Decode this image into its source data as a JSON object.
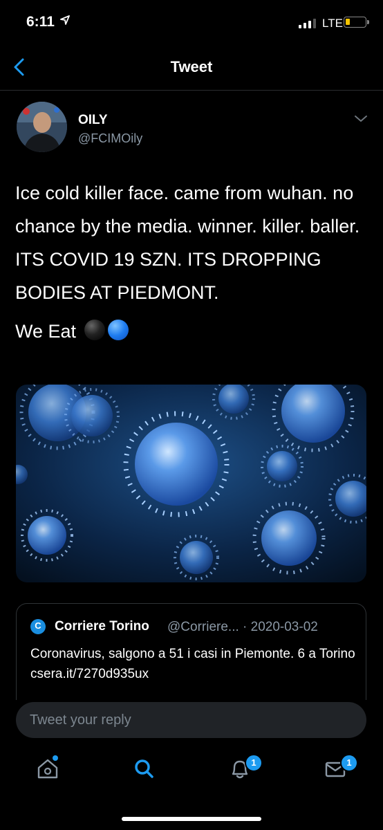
{
  "status_bar": {
    "time": "6:11",
    "network": "LTE"
  },
  "nav": {
    "title": "Tweet"
  },
  "tweet": {
    "author_name": "OILY",
    "author_handle": "@FCIMOily",
    "text_line1": "Ice cold killer face. came from wuhan. no chance by the media. winner. killer. baller. ITS COVID 19 SZN. ITS DROPPING BODIES AT PIEDMONT.",
    "text_line2": "We Eat"
  },
  "quoted_tweet": {
    "logo_letter": "C",
    "name": "Corriere Torino",
    "handle_date": "@Corriere... · 2020-03-02",
    "text": "Coronavirus, salgono a 51 i casi in Piemonte. 6 a Torino csera.it/7270d935ux"
  },
  "reply": {
    "placeholder": "Tweet your reply"
  },
  "tab_bar": {
    "notifications_badge": "1",
    "messages_badge": "1"
  },
  "colors": {
    "accent": "#1d9bf0",
    "background": "#000000",
    "secondary_text": "#8b98a5"
  }
}
